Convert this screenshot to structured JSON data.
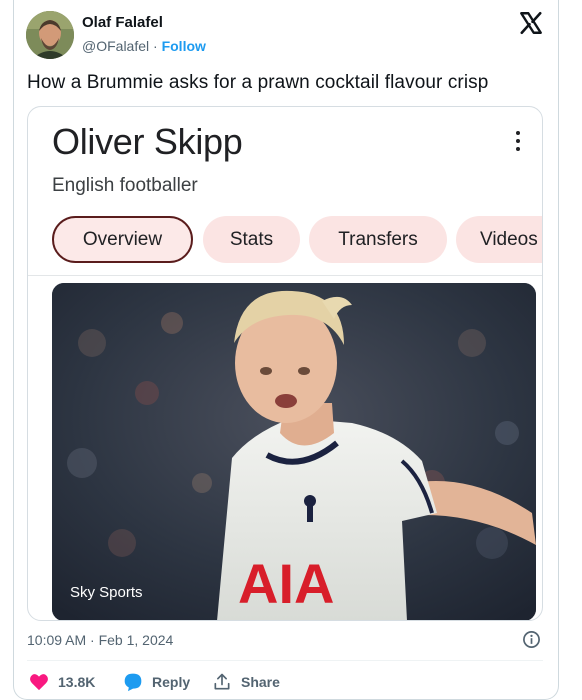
{
  "author": {
    "name": "Olaf Falafel",
    "handle": "@OFalafel",
    "separator": " · ",
    "follow_label": "Follow"
  },
  "tweet": {
    "text": "How a Brummie asks for a prawn cocktail flavour crisp",
    "timestamp": "10:09 AM · Feb 1, 2024"
  },
  "embed": {
    "title": "Oliver Skipp",
    "subtitle": "English footballer",
    "tabs": [
      {
        "label": "Overview",
        "active": true
      },
      {
        "label": "Stats",
        "active": false
      },
      {
        "label": "Transfers",
        "active": false
      },
      {
        "label": "Videos",
        "active": false
      }
    ],
    "image_caption": "Sky Sports",
    "shirt_sponsor": "AIA"
  },
  "actions": {
    "like_count": "13.8K",
    "reply_label": "Reply",
    "share_label": "Share"
  },
  "icons": {
    "brand": "x-logo-icon",
    "more": "more-vert-icon",
    "info": "info-icon",
    "like": "heart-icon",
    "reply": "reply-bubble-icon",
    "share": "share-icon"
  },
  "colors": {
    "follow_link": "#1d9bf0",
    "like_heart": "#f91880",
    "reply_bubble": "#1d9bf0",
    "chip_fill": "#fbe4e3",
    "chip_active_border": "#5a1c1c",
    "secondary_text": "#536471"
  }
}
